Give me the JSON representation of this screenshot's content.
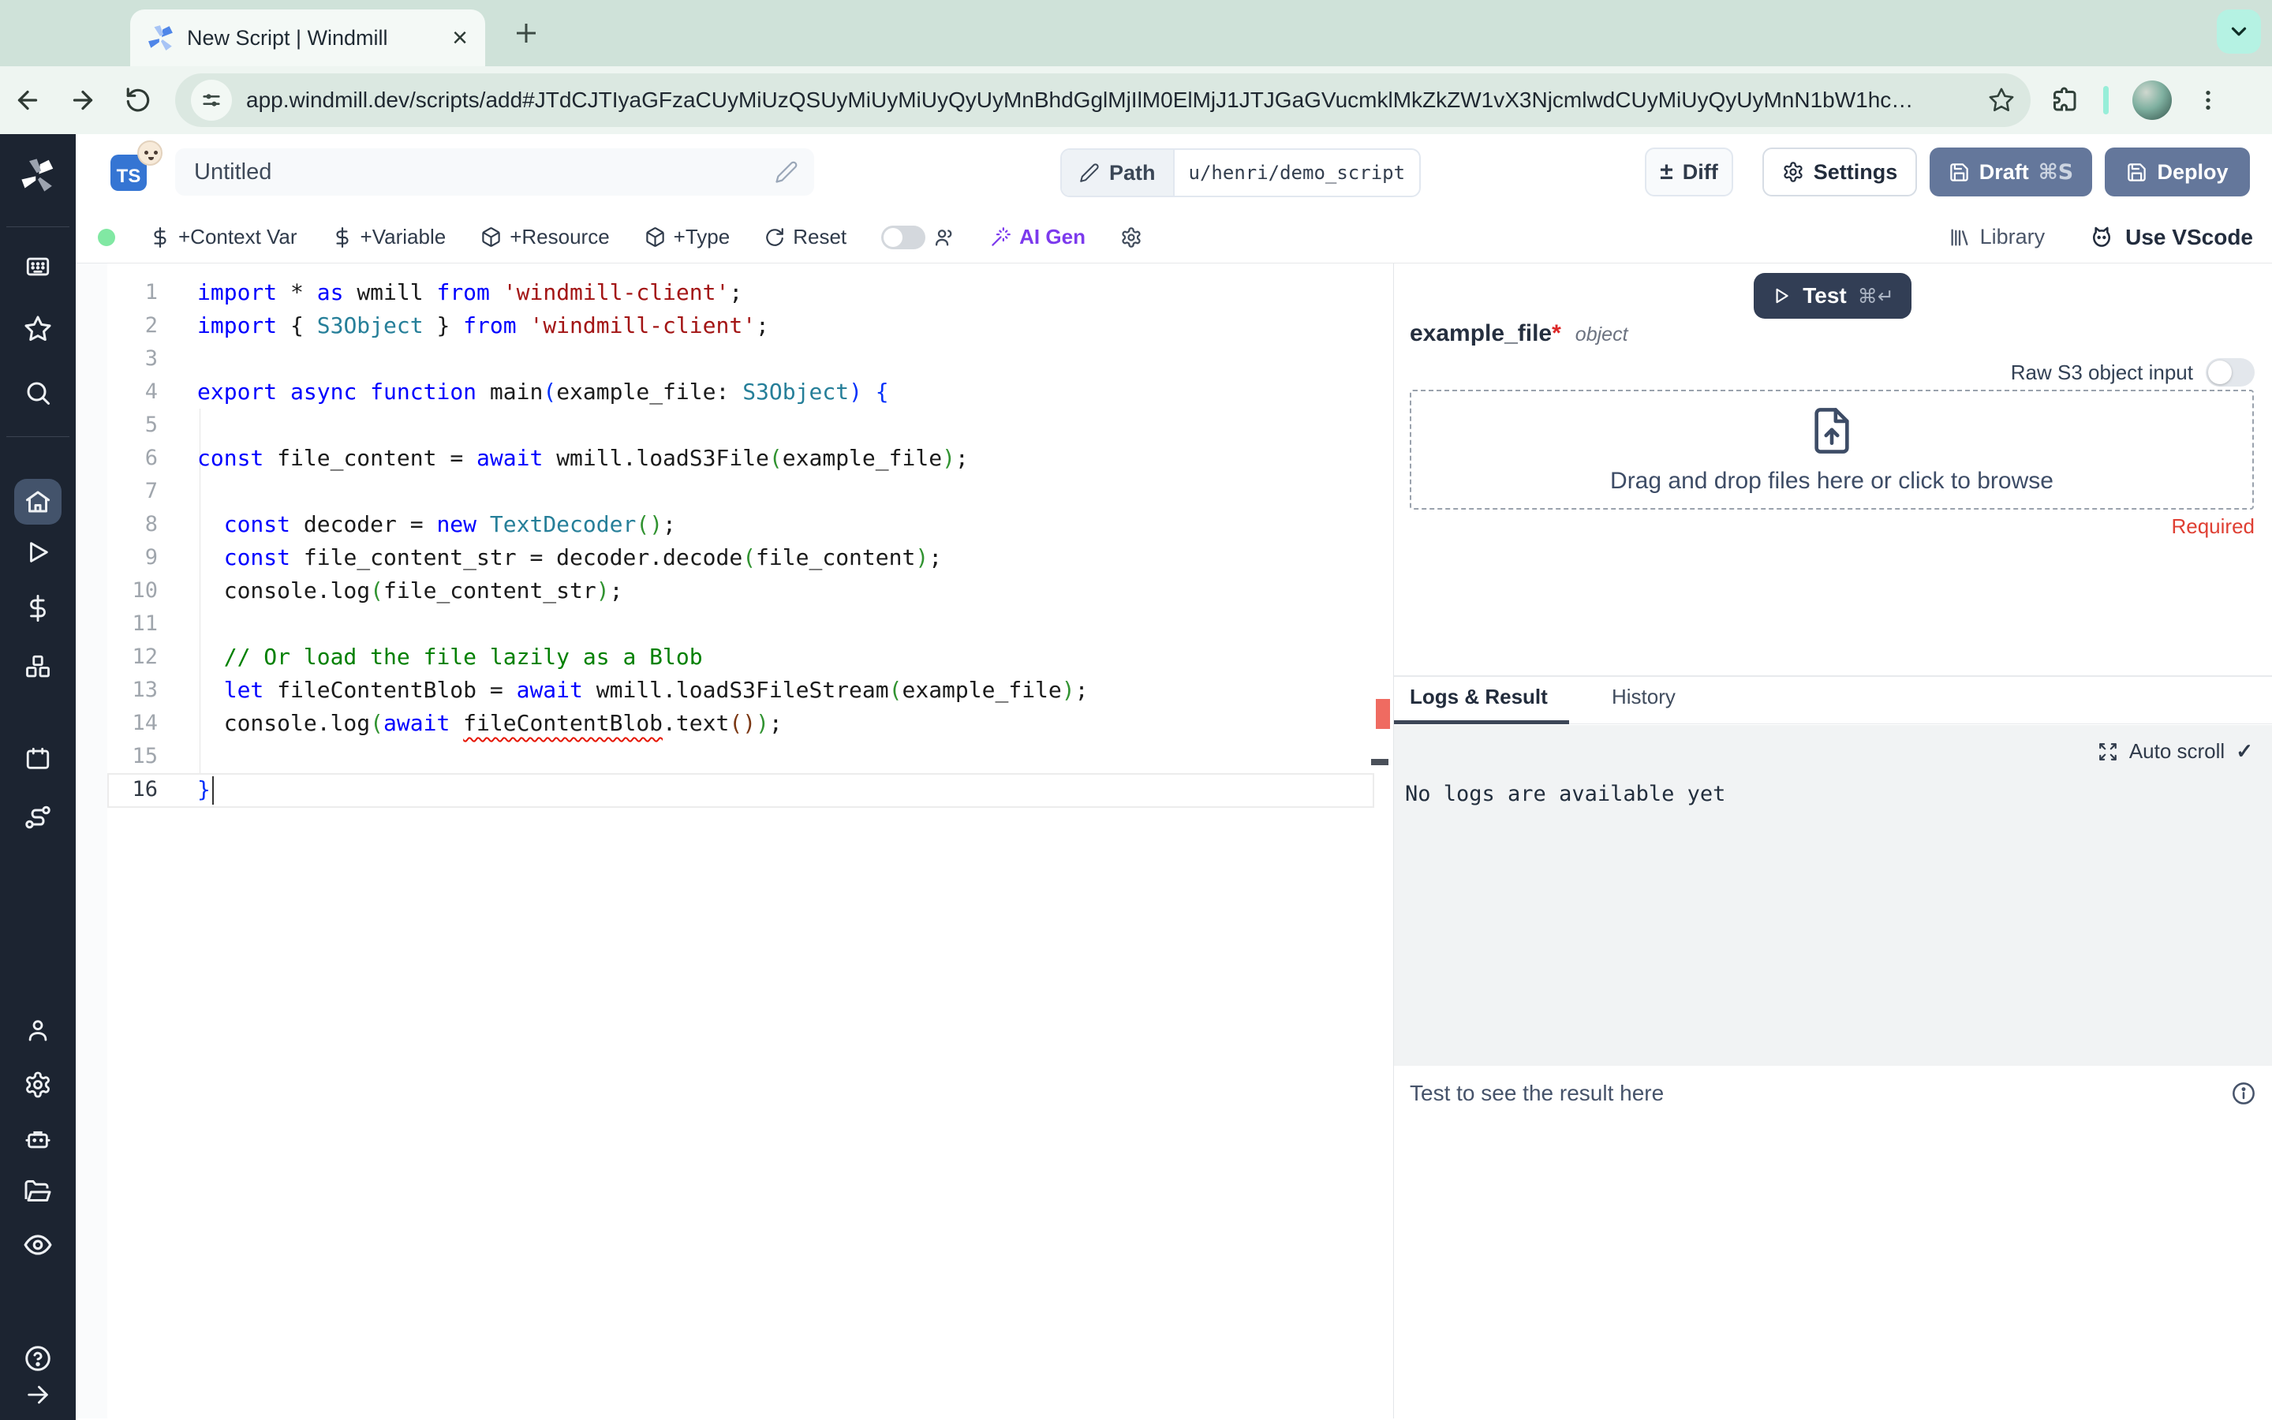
{
  "browser": {
    "tab_title": "New Script | Windmill",
    "close_symbol": "×",
    "new_tab_symbol": "+",
    "url": "app.windmill.dev/scripts/add#JTdCJTIyaGFzaCUyMiUzQSUyMiUyMiUyQyUyMnBhdGglMjIlM0ElMjJ1JTJGaGVucmklMkZkZW1vX3NjcmlwdCUyMiUyQyUyMnN1bW1hc…"
  },
  "header": {
    "lang_badge": "TS",
    "title_value": "Untitled",
    "path_label": "Path",
    "path_value": "u/henri/demo_script",
    "diff_symbol": "±",
    "diff_label": "Diff",
    "settings_label": "Settings",
    "draft_label": "Draft",
    "draft_shortcut": "⌘S",
    "deploy_label": "Deploy"
  },
  "action_bar": {
    "context_var_label": "+Context Var",
    "variable_label": "+Variable",
    "resource_label": "+Resource",
    "type_label": "+Type",
    "reset_label": "Reset",
    "ai_gen_label": "AI Gen",
    "library_label": "Library",
    "use_vscode_label": "Use VScode"
  },
  "sidebar": {
    "items": [
      "windmill-logo",
      "apps",
      "favorites",
      "search",
      "home",
      "runs",
      "variables",
      "resources",
      "schedules",
      "flows",
      "user",
      "settings",
      "workers",
      "folders",
      "audit",
      "help",
      "expand"
    ]
  },
  "editor": {
    "active_line": 16,
    "lines": [
      [
        [
          "import ",
          "k"
        ],
        [
          "* ",
          "d"
        ],
        [
          "as ",
          "k"
        ],
        [
          "wmill ",
          "d"
        ],
        [
          "from ",
          "k"
        ],
        [
          "'windmill-client'",
          "s"
        ],
        [
          ";",
          "d"
        ]
      ],
      [
        [
          "import ",
          "k"
        ],
        [
          "{ ",
          "d"
        ],
        [
          "S3Object ",
          "t"
        ],
        [
          "} ",
          "d"
        ],
        [
          "from ",
          "k"
        ],
        [
          "'windmill-client'",
          "s"
        ],
        [
          ";",
          "d"
        ]
      ],
      [],
      [
        [
          "export ",
          "k"
        ],
        [
          "async ",
          "k"
        ],
        [
          "function ",
          "k"
        ],
        [
          "main",
          "d"
        ],
        [
          "(",
          "p1"
        ],
        [
          "example_file",
          "d"
        ],
        [
          ": ",
          "d"
        ],
        [
          "S3Object",
          "t"
        ],
        [
          ")",
          "p1"
        ],
        [
          " {",
          "p1"
        ]
      ],
      [],
      [
        [
          "const ",
          "k"
        ],
        [
          "file_content ",
          "d"
        ],
        [
          "= ",
          "d"
        ],
        [
          "await ",
          "k"
        ],
        [
          "wmill.loadS3File",
          "d"
        ],
        [
          "(",
          "p2"
        ],
        [
          "example_file",
          "d"
        ],
        [
          ")",
          "p2"
        ],
        [
          ";",
          "d"
        ]
      ],
      [],
      [
        [
          "  ",
          "d"
        ],
        [
          "const ",
          "k"
        ],
        [
          "decoder ",
          "d"
        ],
        [
          "= ",
          "d"
        ],
        [
          "new ",
          "k"
        ],
        [
          "TextDecoder",
          "t"
        ],
        [
          "(",
          "p2"
        ],
        [
          ")",
          "p2"
        ],
        [
          ";",
          "d"
        ]
      ],
      [
        [
          "  ",
          "d"
        ],
        [
          "const ",
          "k"
        ],
        [
          "file_content_str ",
          "d"
        ],
        [
          "= ",
          "d"
        ],
        [
          "decoder.decode",
          "d"
        ],
        [
          "(",
          "p2"
        ],
        [
          "file_content",
          "d"
        ],
        [
          ")",
          "p2"
        ],
        [
          ";",
          "d"
        ]
      ],
      [
        [
          "  ",
          "d"
        ],
        [
          "console.log",
          "d"
        ],
        [
          "(",
          "p2"
        ],
        [
          "file_content_str",
          "d"
        ],
        [
          ")",
          "p2"
        ],
        [
          ";",
          "d"
        ]
      ],
      [],
      [
        [
          "  ",
          "d"
        ],
        [
          "// Or load the file lazily as a Blob",
          "c"
        ]
      ],
      [
        [
          "  ",
          "d"
        ],
        [
          "let ",
          "k"
        ],
        [
          "fileContentBlob ",
          "d"
        ],
        [
          "= ",
          "d"
        ],
        [
          "await ",
          "k"
        ],
        [
          "wmill.loadS3FileStream",
          "d"
        ],
        [
          "(",
          "p2"
        ],
        [
          "example_file",
          "d"
        ],
        [
          ")",
          "p2"
        ],
        [
          ";",
          "d"
        ]
      ],
      [
        [
          "  ",
          "d"
        ],
        [
          "console.log",
          "d"
        ],
        [
          "(",
          "p2"
        ],
        [
          "await ",
          "k"
        ],
        [
          "fileContentBlob",
          "e"
        ],
        [
          ".text",
          "d"
        ],
        [
          "(",
          "p3"
        ],
        [
          ")",
          "p3"
        ],
        [
          ")",
          "p2"
        ],
        [
          ";",
          "d"
        ]
      ],
      [],
      [
        [
          "}",
          "p1"
        ]
      ]
    ]
  },
  "right_panel": {
    "test_label": "Test",
    "test_shortcut": "⌘↵",
    "arg_name": "example_file",
    "required_star": "*",
    "arg_type": "object",
    "raw_s3_label": "Raw S3 object input",
    "dropzone_text": "Drag and drop files here or click to browse",
    "required_label": "Required",
    "tab_logs": "Logs & Result",
    "tab_history": "History",
    "auto_scroll_label": "Auto scroll",
    "check_symbol": "✓",
    "no_logs_text": "No logs are available yet",
    "result_placeholder": "Test to see the result here"
  },
  "colors": {
    "lang_badge_blue": "#3575d3",
    "primary_button_slate": "#64779b",
    "test_button_navy": "#323e55",
    "ai_gen_purple": "#7c3aed",
    "required_red": "#df3f33",
    "live_green": "#81e8a3",
    "error_marker": "#ef6b61"
  }
}
